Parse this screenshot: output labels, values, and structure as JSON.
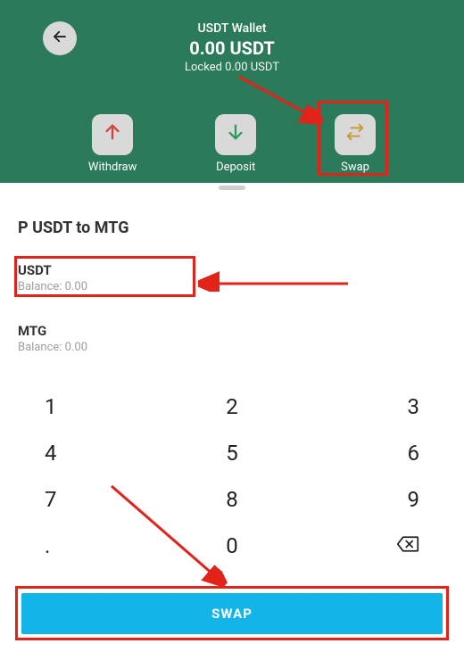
{
  "header": {
    "wallet_label": "USDT Wallet",
    "balance": "0.00 USDT",
    "locked": "Locked 0.00 USDT"
  },
  "actions": {
    "withdraw": {
      "label": "Withdraw",
      "icon": "arrow-up"
    },
    "deposit": {
      "label": "Deposit",
      "icon": "arrow-down"
    },
    "swap": {
      "label": "Swap",
      "icon": "swap"
    }
  },
  "section_title": "P USDT to MTG",
  "fields": {
    "from": {
      "symbol": "USDT",
      "balance_label": "Balance: 0.00"
    },
    "to": {
      "symbol": "MTG",
      "balance_label": "Balance: 0.00"
    }
  },
  "keypad": {
    "k1": "1",
    "k2": "2",
    "k3": "3",
    "k4": "4",
    "k5": "5",
    "k6": "6",
    "k7": "7",
    "k8": "8",
    "k9": "9",
    "dot": ".",
    "k0": "0",
    "backspace": "⌫"
  },
  "swap_button_label": "SWAP",
  "colors": {
    "header_bg": "#2b7a5a",
    "primary_button": "#13b5e8",
    "annotation_red": "#e2231a",
    "arrow_up": "#d1443a",
    "arrow_down": "#2f9a5f",
    "swap_icon": "#c79a3a"
  }
}
